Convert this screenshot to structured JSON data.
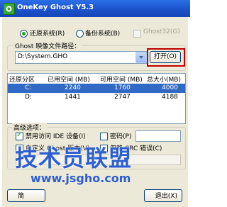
{
  "window": {
    "title": "OneKey Ghost Y5.3"
  },
  "mode": {
    "restore_label": "还原系统(R)",
    "backup_label": "备份系统(B)",
    "ghost32_label": "Ghost32(G)"
  },
  "image_path": {
    "group_label": "Ghost 映像文件路径：",
    "value": "D:\\System.GHO",
    "open_button": "打开(O)"
  },
  "partitions": {
    "headers": [
      "还原分区",
      "已用空间 (MB)",
      "可用空间 (MB)",
      "总大小(MB)"
    ],
    "rows": [
      {
        "drive": "C:",
        "used": "2240",
        "free": "1760",
        "total": "4000",
        "selected": true
      },
      {
        "drive": "D:",
        "used": "1441",
        "free": "2747",
        "total": "4188",
        "selected": false
      }
    ]
  },
  "advanced": {
    "group_label": "高级选项：",
    "disable_ide_label": "禁用访问 IDE 设备(I)",
    "password_label": "密码(P)",
    "custom_ghost_label": "自定义 Ghost 版本(V)",
    "ignore_crc_label": "忽略 CRC 错误(C)"
  },
  "buttons": {
    "left_partial": "简",
    "right_partial": "退出(X)"
  },
  "watermark": {
    "main": "技术员联盟",
    "url": "www.jsgho.com"
  },
  "colors": {
    "highlight": "#c00000",
    "selection": "#316ac5",
    "watermark": "#2d5fcf"
  }
}
